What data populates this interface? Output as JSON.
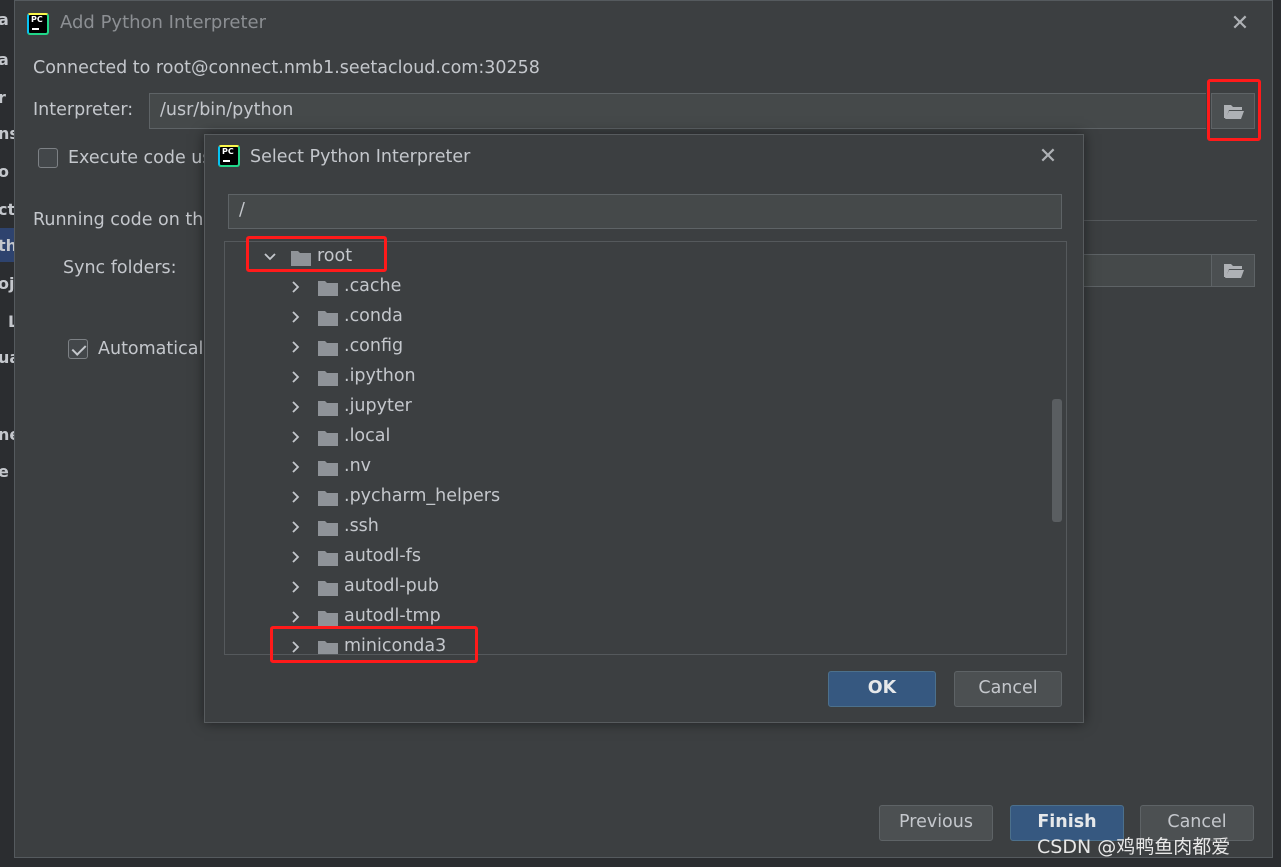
{
  "outer_dialog": {
    "title": "Add Python Interpreter",
    "connection": "Connected to root@connect.nmb1.seetacloud.com:30258",
    "interpreter_label": "Interpreter:",
    "interpreter_value": "/usr/bin/python",
    "execute_label": "Execute code us",
    "running_label": "Running code on th",
    "sync_label": "Sync folders:",
    "auto_label": "Automatical",
    "buttons": {
      "previous": "Previous",
      "finish": "Finish",
      "cancel": "Cancel"
    }
  },
  "inner_dialog": {
    "title": "Select Python Interpreter",
    "path": "/",
    "tree": {
      "root": "root",
      "children": [
        ".cache",
        ".conda",
        ".config",
        ".ipython",
        ".jupyter",
        ".local",
        ".nv",
        ".pycharm_helpers",
        ".ssh",
        "autodl-fs",
        "autodl-pub",
        "autodl-tmp",
        "miniconda3"
      ]
    },
    "buttons": {
      "ok": "OK",
      "cancel": "Cancel"
    }
  },
  "ide_fragments": [
    "a",
    "a",
    "r",
    "ns",
    "o",
    "ct",
    "th",
    "oj",
    "L",
    "ua",
    "ne",
    "e"
  ],
  "watermark": "CSDN @鸡鸭鱼肉都爱",
  "colors": {
    "highlight_box": "#ff1a1a",
    "primary_button": "#365880",
    "dialog_bg": "#3c3f41"
  }
}
